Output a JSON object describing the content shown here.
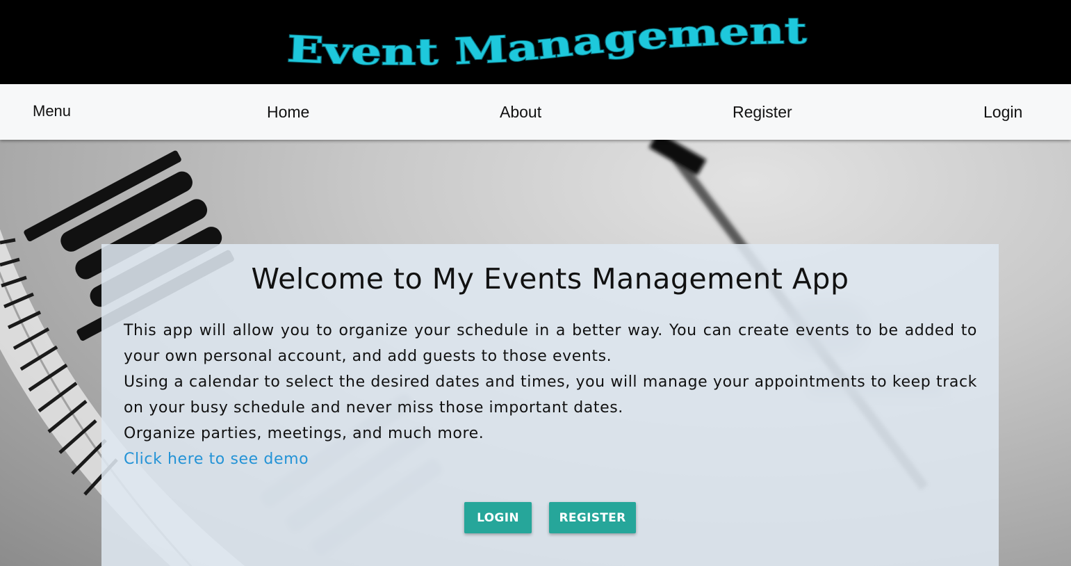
{
  "header": {
    "logo_text": "Event Management",
    "logo_color": "#1ec8dc"
  },
  "nav": {
    "menu_label": "Menu",
    "home_label": "Home",
    "about_label": "About",
    "register_label": "Register",
    "login_label": "Login"
  },
  "hero": {
    "background_image": "clock-face-image"
  },
  "welcome": {
    "title": "Welcome to My Events Management App",
    "paragraph1": "This app will allow you to organize your schedule in a better way. You can create events to be added to your own personal account, and add guests to those events.",
    "paragraph2": "Using a calendar to select the desired dates and times, you will manage your appointments to keep track on your busy schedule and never miss those important dates.",
    "paragraph3": "Organize parties, meetings, and much more.",
    "demo_link": "Click here to see demo",
    "link_color": "#2493d6"
  },
  "buttons": {
    "login_label": "LOGIN",
    "register_label": "REGISTER",
    "button_color": "#26a69a"
  }
}
